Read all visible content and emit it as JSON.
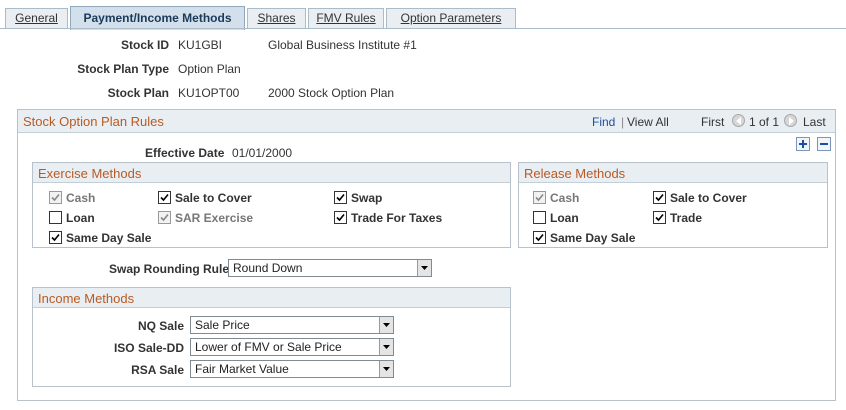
{
  "tabs": [
    {
      "label": "General"
    },
    {
      "label": "Payment/Income Methods"
    },
    {
      "label": "Shares"
    },
    {
      "label": "FMV Rules"
    },
    {
      "label": "Option Parameters"
    }
  ],
  "header": {
    "stock_id_label": "Stock ID",
    "stock_id": "KU1GBI",
    "stock_id_desc": "Global Business Institute #1",
    "plan_type_label": "Stock Plan Type",
    "plan_type": "Option Plan",
    "plan_label": "Stock Plan",
    "plan": "KU1OPT00",
    "plan_desc": "2000 Stock Option Plan"
  },
  "rules": {
    "title": "Stock Option Plan Rules",
    "find": "Find",
    "separator": "|",
    "view_all": "View All",
    "first": "First",
    "page": "1 of 1",
    "last": "Last",
    "effective_date_label": "Effective Date",
    "effective_date": "01/01/2000"
  },
  "exercise_methods": {
    "title": "Exercise Methods",
    "items": [
      {
        "label": "Cash",
        "checked": true,
        "disabled": true
      },
      {
        "label": "Sale to Cover",
        "checked": true,
        "disabled": false
      },
      {
        "label": "Swap",
        "checked": true,
        "disabled": false
      },
      {
        "label": "Loan",
        "checked": false,
        "disabled": false
      },
      {
        "label": "SAR Exercise",
        "checked": true,
        "disabled": true
      },
      {
        "label": "Trade For Taxes",
        "checked": true,
        "disabled": false
      },
      {
        "label": "Same Day Sale",
        "checked": true,
        "disabled": false
      }
    ]
  },
  "release_methods": {
    "title": "Release Methods",
    "items": [
      {
        "label": "Cash",
        "checked": true,
        "disabled": true
      },
      {
        "label": "Sale to Cover",
        "checked": true,
        "disabled": false
      },
      {
        "label": "Loan",
        "checked": false,
        "disabled": false
      },
      {
        "label": "Trade",
        "checked": true,
        "disabled": false
      },
      {
        "label": "Same Day Sale",
        "checked": true,
        "disabled": false
      }
    ]
  },
  "swap_rounding": {
    "label": "Swap Rounding Rule",
    "value": "Round Down"
  },
  "income_methods": {
    "title": "Income Methods",
    "nq_label": "NQ Sale",
    "nq_value": "Sale Price",
    "iso_label": "ISO Sale-DD",
    "iso_value": "Lower of FMV or Sale Price",
    "rsa_label": "RSA Sale",
    "rsa_value": "Fair Market Value"
  },
  "colors": {
    "section_title": "#b95a22",
    "link": "#1d4f9c",
    "tab_active_bg": "#d3dfea"
  },
  "icons": [
    "first-arrow-icon",
    "last-arrow-icon",
    "add-row-icon",
    "delete-row-icon",
    "checkmark-icon",
    "dropdown-arrow-icon"
  ]
}
